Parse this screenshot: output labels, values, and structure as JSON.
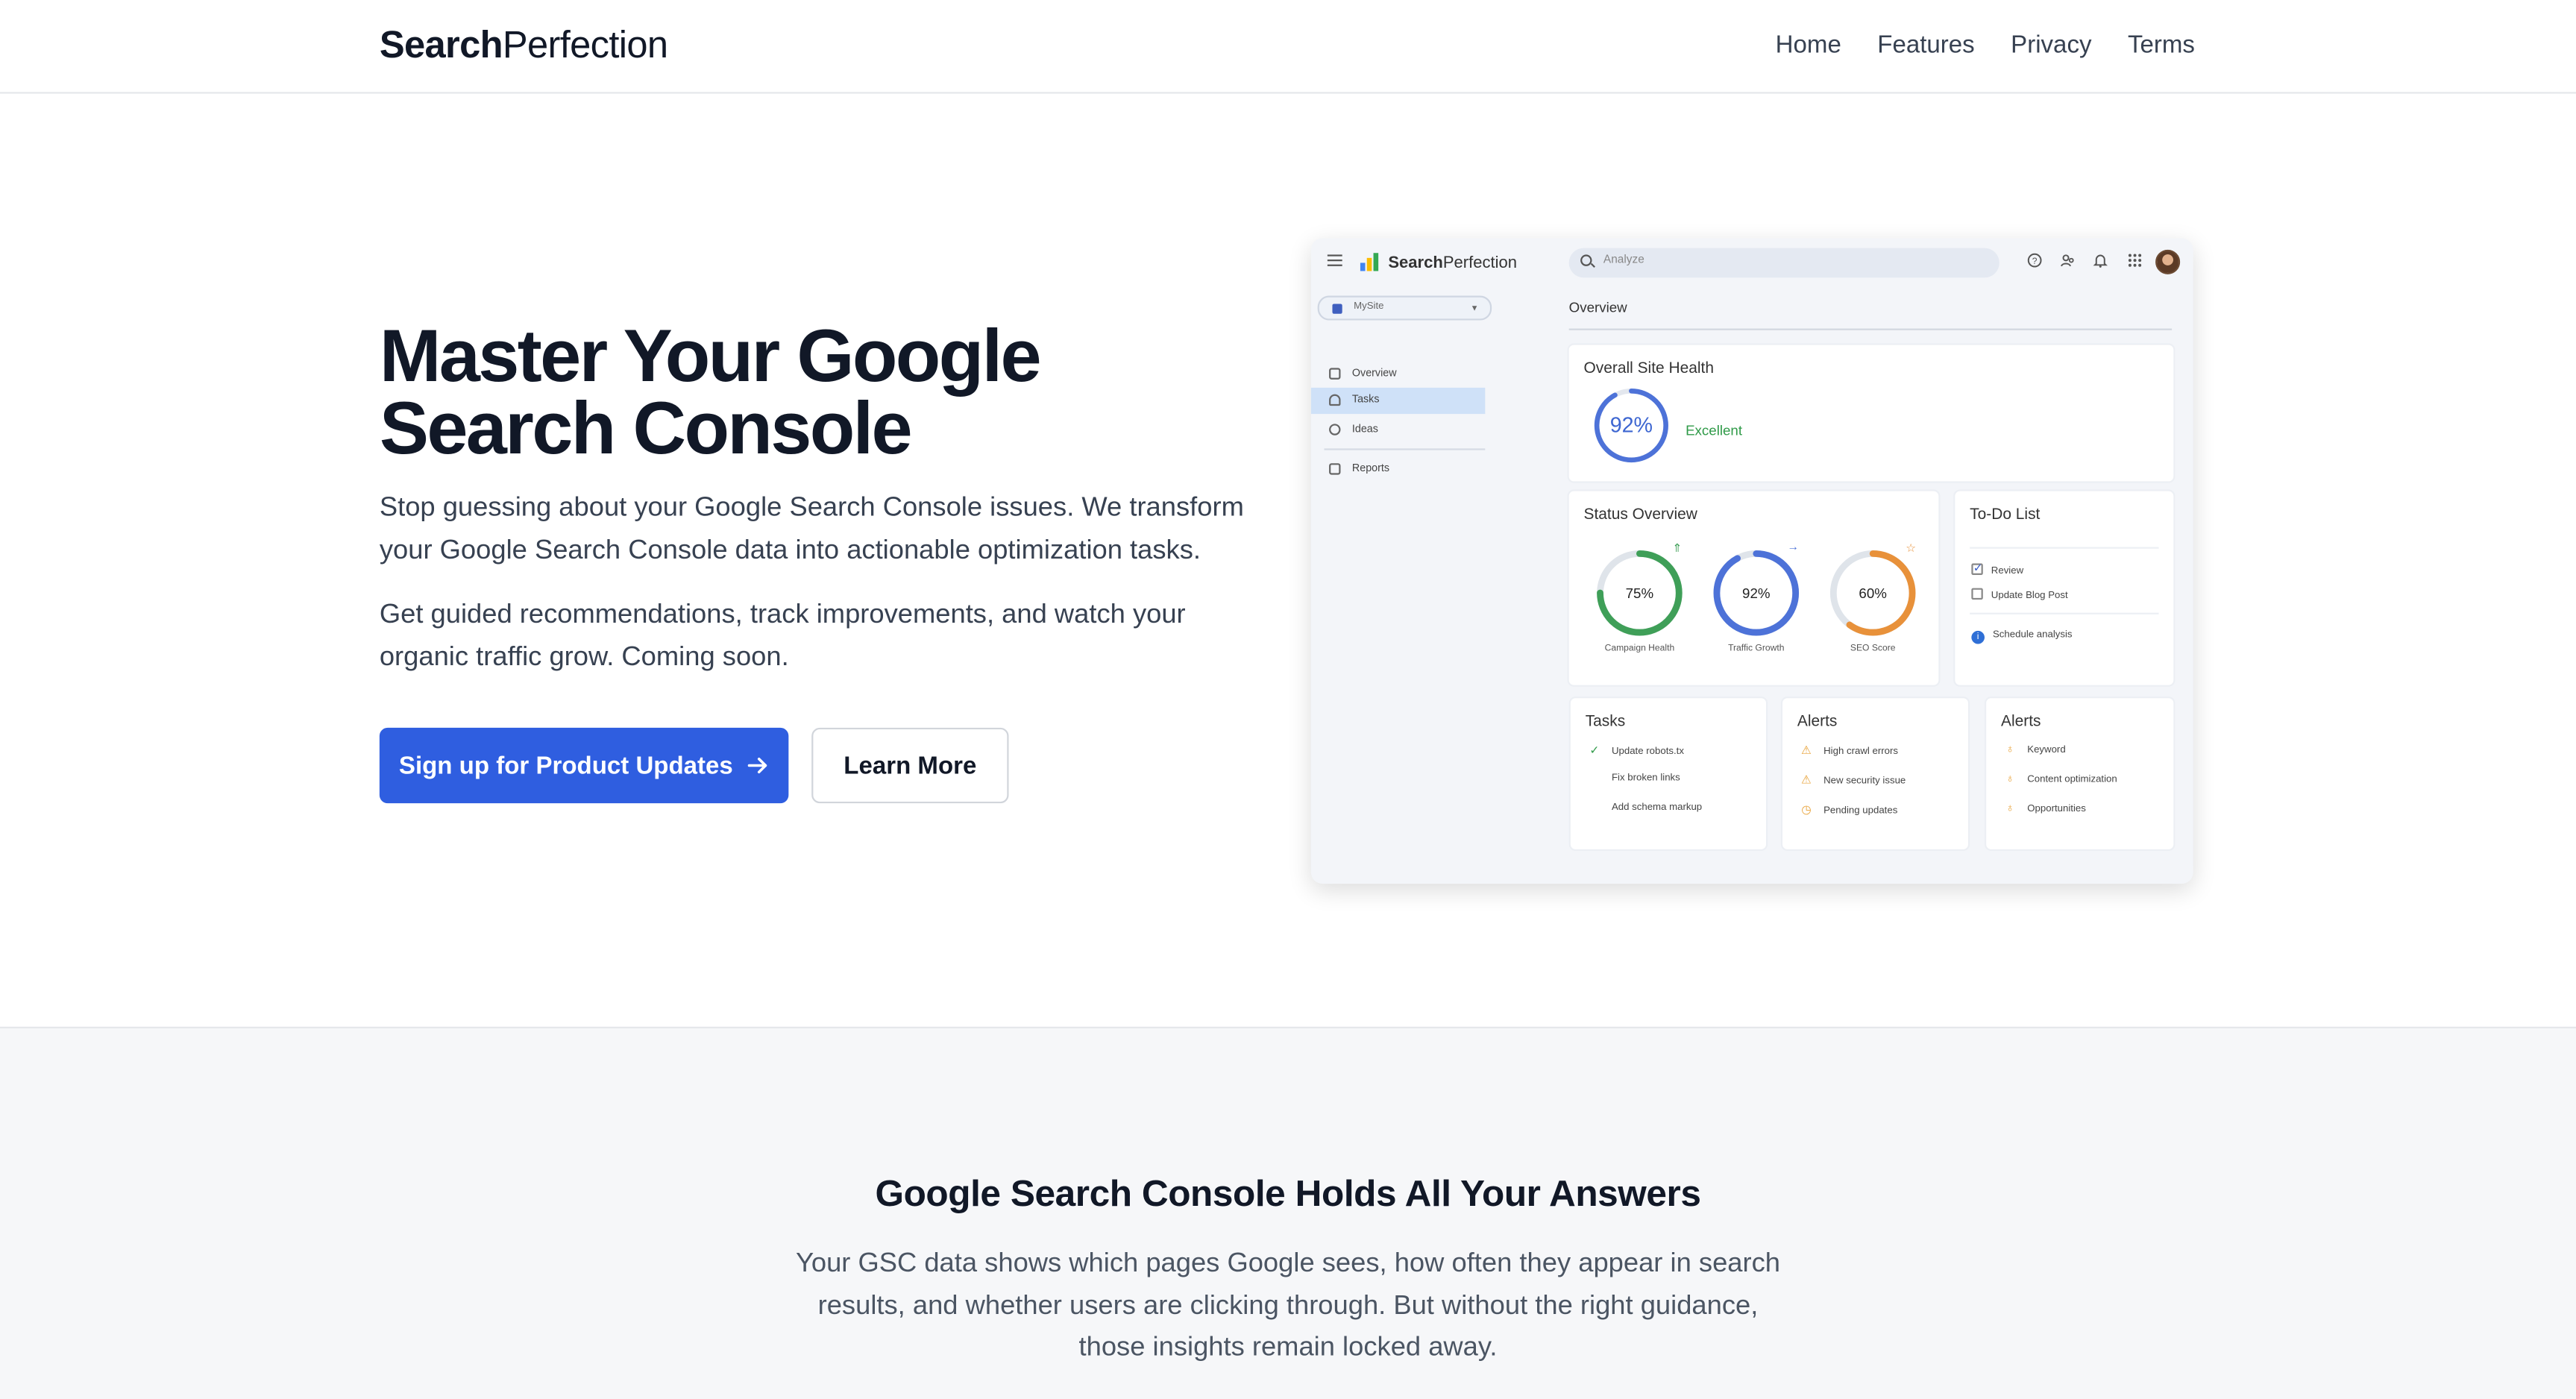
{
  "nav": {
    "brand_bold": "Search",
    "brand_light": "Perfection",
    "links": [
      "Home",
      "Features",
      "Privacy",
      "Terms"
    ]
  },
  "hero": {
    "title": "Master Your Google Search Console",
    "paragraph1": "Stop guessing about your Google Search Console issues. We transform your Google Search Console data into actionable optimization tasks.",
    "paragraph2": "Get guided recommendations, track improvements, and watch your organic traffic grow. Coming soon.",
    "primary_button": "Sign up for Product Updates",
    "secondary_button": "Learn More"
  },
  "mockup": {
    "brand_bold": "Search",
    "brand_light": "Perfection",
    "search_placeholder": "Analyze",
    "site_selector": "MySite",
    "sidebar": [
      "Overview",
      "Tasks",
      "Ideas",
      "Reports"
    ],
    "sidebar_active": "Tasks",
    "page_heading": "Overview",
    "site_health": {
      "title": "Overall Site Health",
      "value": "92%",
      "percent": 92,
      "label": "Excellent"
    },
    "status": {
      "title": "Status Overview",
      "gauges": [
        {
          "label": "Campaign Health",
          "value": "75%",
          "percent": 75,
          "color": "#3f9f58"
        },
        {
          "label": "Traffic Growth",
          "value": "92%",
          "percent": 92,
          "color": "#4d72d8"
        },
        {
          "label": "SEO Score",
          "value": "60%",
          "percent": 60,
          "color": "#e8913a"
        }
      ]
    },
    "todo": {
      "title": "To-Do List",
      "items": [
        "Review",
        "Update Blog Post"
      ],
      "action": "Schedule analysis"
    },
    "tasks": {
      "title": "Tasks",
      "items": [
        "Update robots.tx",
        "Fix broken links",
        "Add schema markup"
      ]
    },
    "alerts1": {
      "title": "Alerts",
      "items": [
        "High crawl errors",
        "New security issue",
        "Pending updates"
      ]
    },
    "alerts2": {
      "title": "Alerts",
      "items": [
        "Keyword",
        "Content optimization",
        "Opportunities"
      ]
    },
    "colors": {
      "accent": "#2f5ee0",
      "success": "#2f9a48",
      "warning": "#e8a33a"
    }
  },
  "section2": {
    "title": "Google Search Console Holds All Your Answers",
    "body": "Your GSC data shows which pages Google sees, how often they appear in search results, and whether users are clicking through. But without the right guidance, those insights remain locked away."
  }
}
